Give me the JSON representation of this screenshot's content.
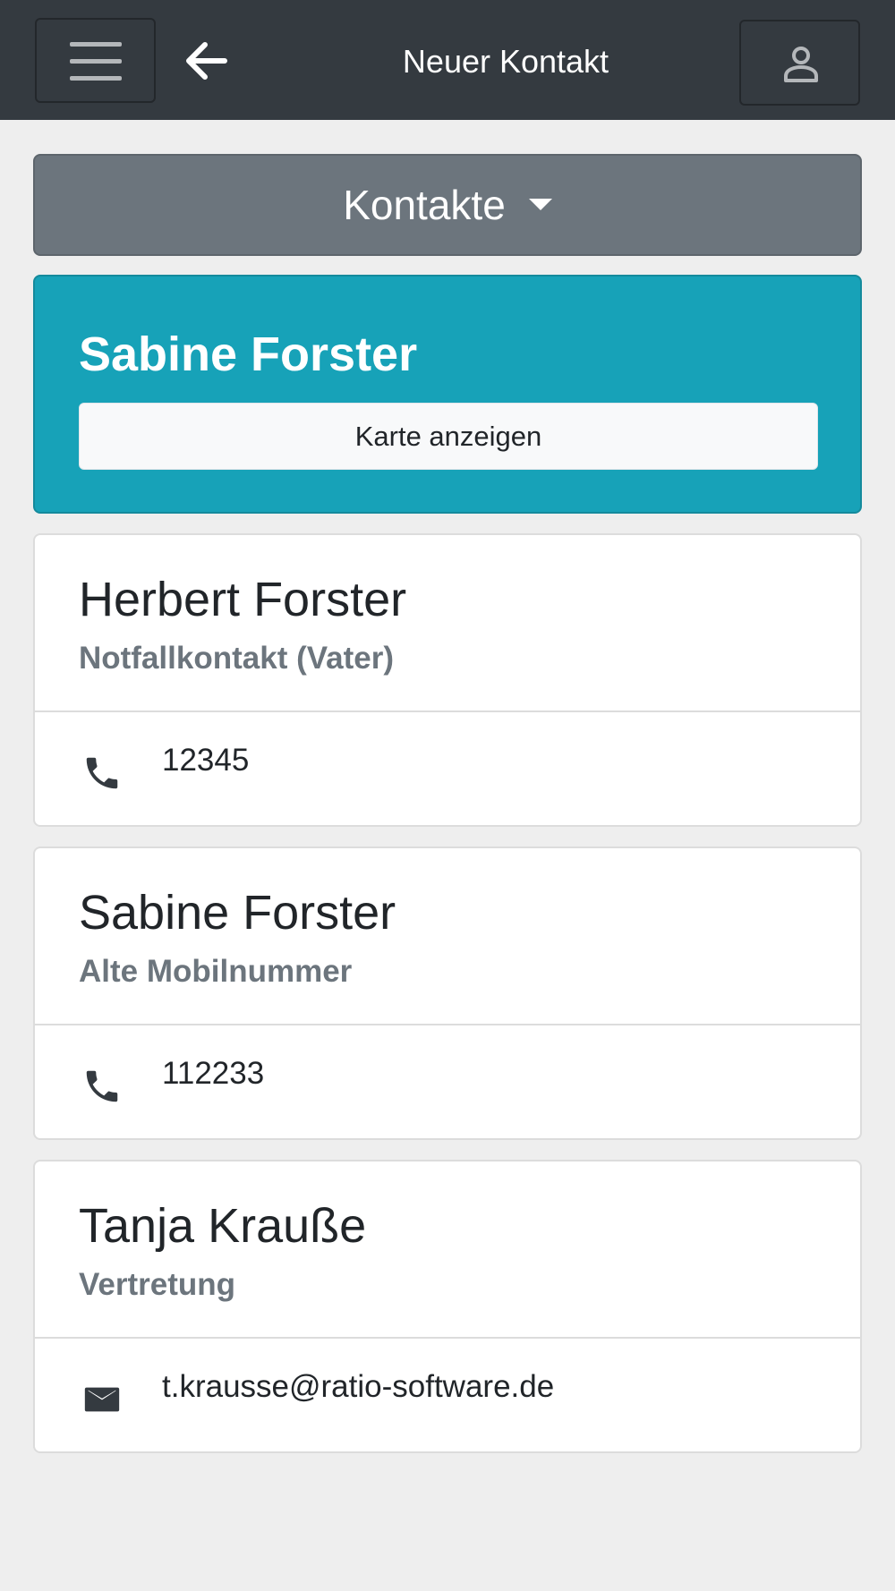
{
  "header": {
    "title": "Neuer Kontakt",
    "menu_icon": "hamburger-menu-icon",
    "back_icon": "arrow-left-icon",
    "user_icon": "user-icon"
  },
  "dropdown": {
    "label": "Kontakte",
    "icon": "caret-down-icon"
  },
  "highlight": {
    "name": "Sabine Forster",
    "button_label": "Karte anzeigen"
  },
  "contacts": [
    {
      "name": "Herbert Forster",
      "subtitle": "Notfallkontakt (Vater)",
      "type": "phone",
      "icon": "phone-icon",
      "value": "12345"
    },
    {
      "name": "Sabine Forster",
      "subtitle": "Alte Mobilnummer",
      "type": "phone",
      "icon": "phone-icon",
      "value": "112233"
    },
    {
      "name": "Tanja Krauße",
      "subtitle": "Vertretung",
      "type": "email",
      "icon": "mail-icon",
      "value": "t.krausse@ratio-software.de"
    }
  ],
  "colors": {
    "header_bg": "#343a40",
    "dropdown_bg": "#6c757d",
    "highlight_bg": "#17a2b8",
    "page_bg": "#eeeeee"
  }
}
